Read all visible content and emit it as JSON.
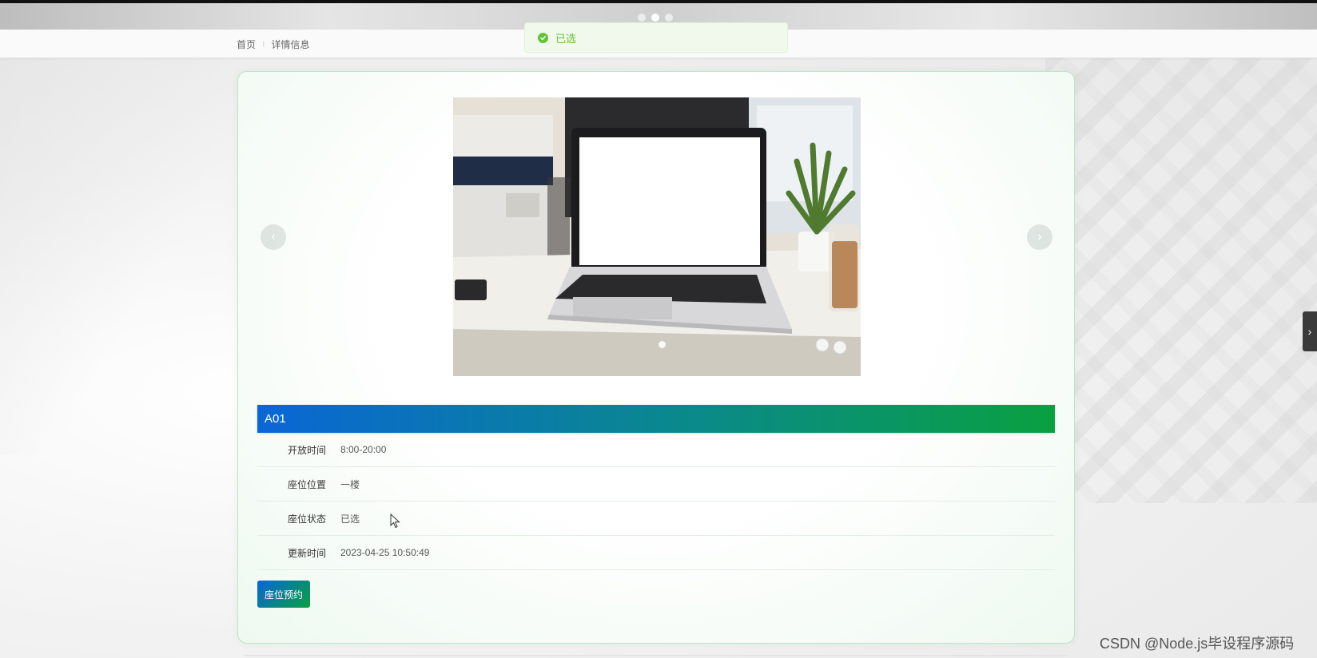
{
  "breadcrumb": {
    "home": "首页",
    "current": "详情信息"
  },
  "toast": {
    "message": "已选",
    "color": "#67c23a"
  },
  "carousel": {
    "prev": "‹",
    "next": "›"
  },
  "seat": {
    "title": "A01",
    "details": [
      {
        "label": "开放时间",
        "value": "8:00-20:00"
      },
      {
        "label": "座位位置",
        "value": "一楼"
      },
      {
        "label": "座位状态",
        "value": "已选"
      },
      {
        "label": "更新时间",
        "value": "2023-04-25 10:50:49"
      }
    ],
    "reserve_label": "座位预约"
  },
  "side_tab": {
    "label": "›"
  },
  "watermark": "CSDN @Node.js毕设程序源码",
  "colors": {
    "accent_start": "#0a66d6",
    "accent_end": "#0aa041"
  }
}
